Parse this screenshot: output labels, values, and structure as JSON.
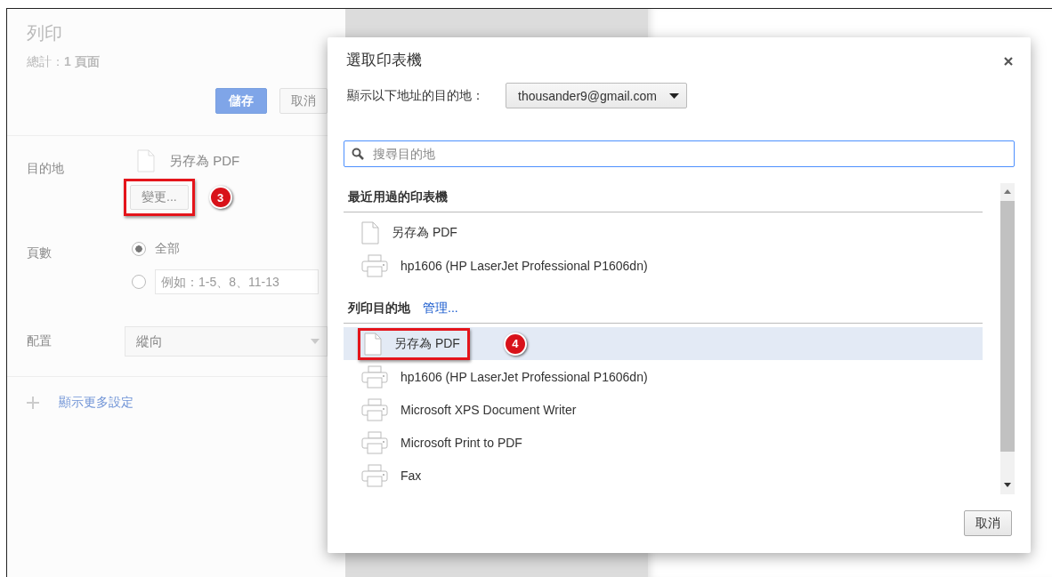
{
  "print_panel": {
    "title": "列印",
    "total": "總計：**1 頁面**",
    "buttons": [
      {
        "label": "儲存",
        "kind": "primary"
      },
      {
        "label": "取消",
        "kind": "plain"
      }
    ],
    "destination": {
      "label": "目的地",
      "name": "另存為 PDF",
      "change": "變更...",
      "callout": "3"
    },
    "pages": {
      "label": "頁數",
      "options": [
        {
          "kind": "all",
          "label": "全部",
          "selected": true
        },
        {
          "kind": "range",
          "placeholder": "例如：1-5、8、11-13",
          "selected": false
        }
      ]
    },
    "layout": {
      "label": "配置",
      "value": "縱向"
    },
    "more_settings": "顯示更多設定"
  },
  "dialog": {
    "title": "選取印表機",
    "account_label": "顯示以下地址的目的地：",
    "account": "thousander9@gmail.com",
    "search": {
      "placeholder": "搜尋目的地"
    },
    "recent": {
      "heading": "最近用過的印表機",
      "items": [
        {
          "name": "另存為 PDF",
          "kind": "pdf"
        },
        {
          "name": "hp1606 (HP LaserJet Professional P1606dn)",
          "kind": "printer"
        }
      ]
    },
    "destinations": {
      "heading": "列印目的地",
      "manage": "管理...",
      "items": [
        {
          "name": "另存為 PDF",
          "kind": "pdf",
          "selected": true,
          "callout": "4"
        },
        {
          "name": "hp1606 (HP LaserJet Professional P1606dn)",
          "kind": "printer",
          "selected": false
        },
        {
          "name": "Microsoft XPS Document Writer",
          "kind": "printer",
          "selected": false
        },
        {
          "name": "Microsoft Print to PDF",
          "kind": "printer",
          "selected": false
        },
        {
          "name": "Fax",
          "kind": "printer",
          "selected": false
        }
      ]
    },
    "cancel": "取消"
  }
}
